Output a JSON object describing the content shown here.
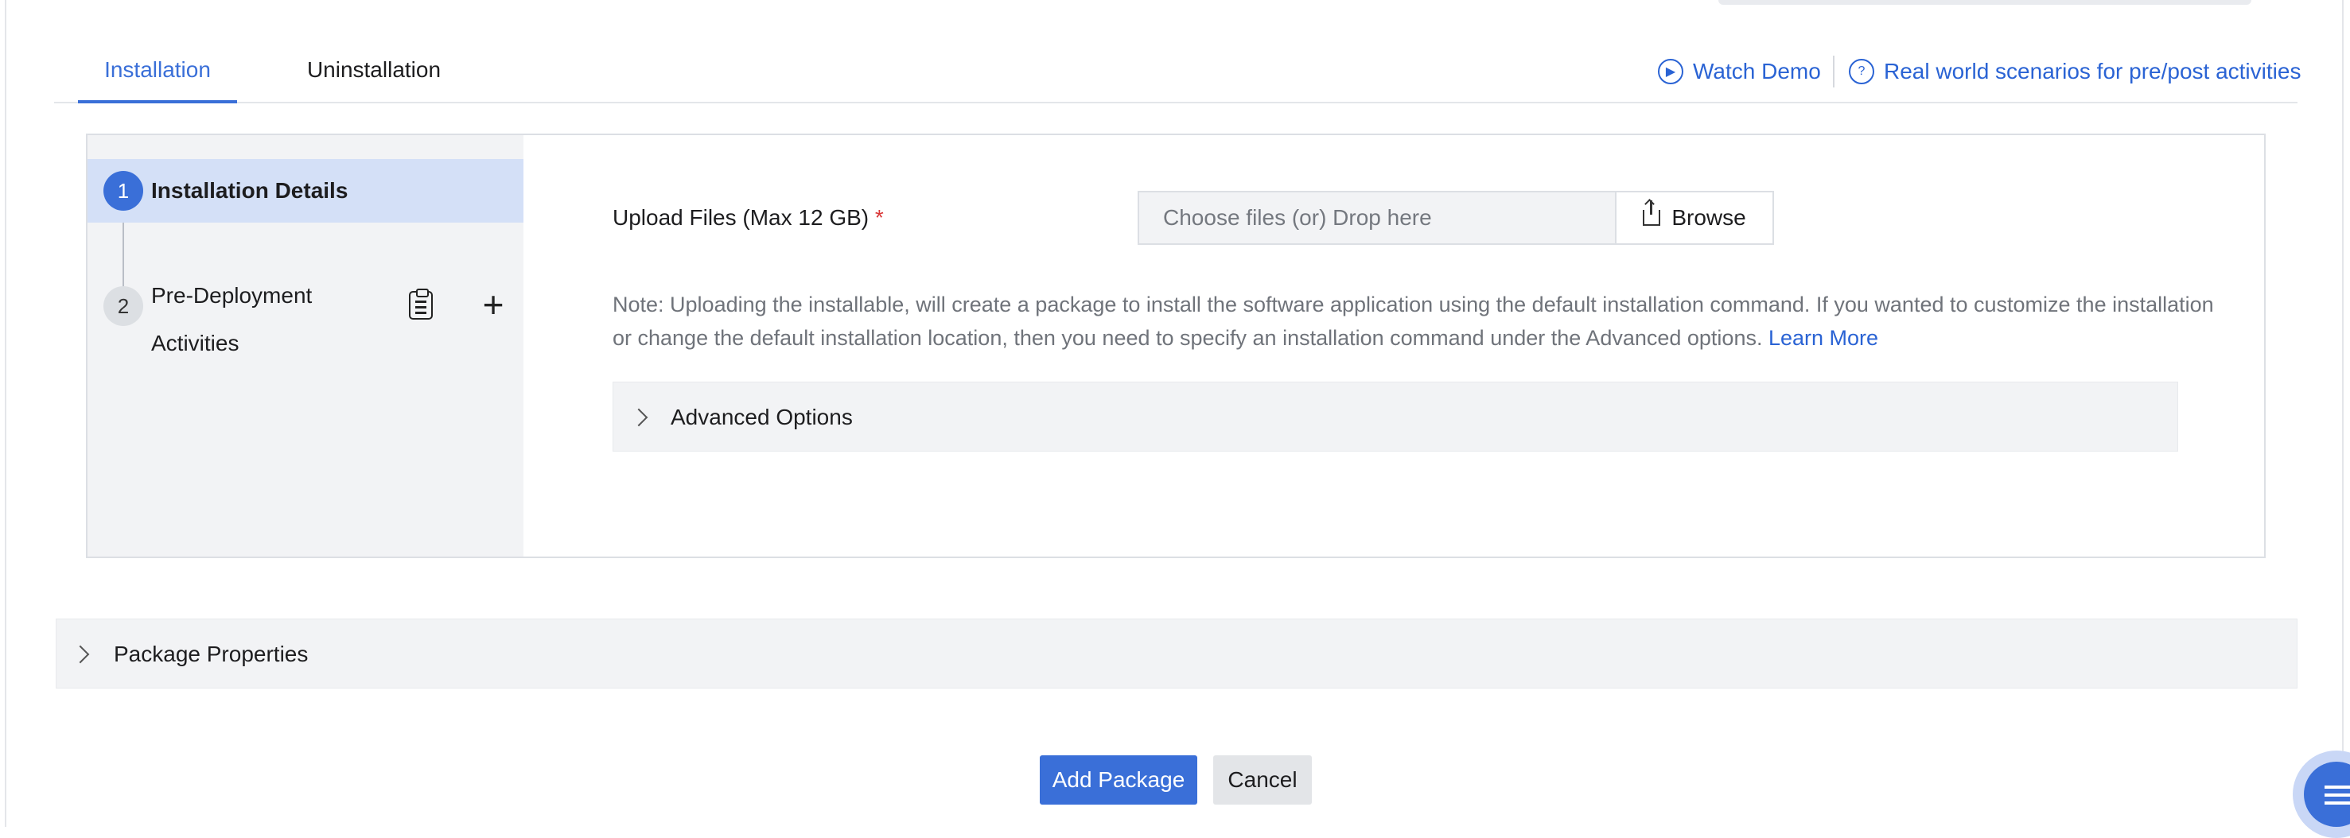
{
  "tabs": [
    {
      "label": "Installation",
      "active": true
    },
    {
      "label": "Uninstallation",
      "active": false
    }
  ],
  "links": {
    "watch_demo": "Watch Demo",
    "real_world": "Real world scenarios for pre/post activities"
  },
  "steps": [
    {
      "number": "1",
      "label": "Installation Details",
      "active": true
    },
    {
      "number": "2",
      "label": "Pre-Deployment Activities",
      "active": false
    }
  ],
  "upload": {
    "label": "Upload Files (Max 12 GB)",
    "required_mark": "*",
    "placeholder": "Choose files (or) Drop here",
    "browse_label": "Browse"
  },
  "note": {
    "text": "Note: Uploading the installable, will create a package to install the software application using the default installation command. If you wanted to customize the installation or change the default installation location, then you need to specify an installation command under the Advanced options.",
    "learn_more": "Learn More"
  },
  "advanced_options": "Advanced Options",
  "package_properties": "Package Properties",
  "buttons": {
    "add": "Add Package",
    "cancel": "Cancel"
  },
  "colors": {
    "accent": "#3a6fd8",
    "link": "#2a63d4",
    "required": "#d93838"
  }
}
